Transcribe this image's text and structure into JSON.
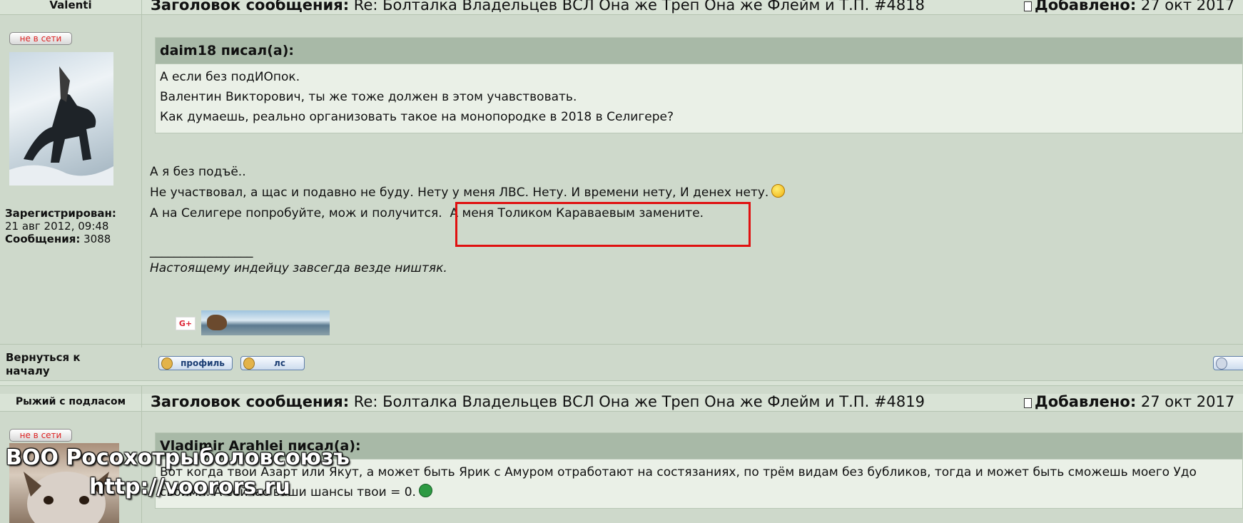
{
  "post1": {
    "author": "Valenti",
    "subject_label": "Заголовок сообщения:",
    "subject": "Re: Болталка Владельцев ВСЛ Она же Треп Она же Флейм и Т.П. #4818",
    "added_label": "Добавлено:",
    "added_value": "27 окт 2017",
    "status": "не в сети",
    "quote_author": "daim18 писал(а):",
    "quote_lines": [
      "А если без подИОпок.",
      "Валентин Викторович, ты же тоже должен в этом учавствовать.",
      "Как думаешь, реально организовать такое на монопородке в 2018 в Селигере?"
    ],
    "body_lines": [
      "А я без подъё..",
      "Не участвовал, а щас и подавно не буду. Нету у меня ЛВС. Нету. И времени нету, И денех нету.",
      "А на Селигере попробуйте, мож и получится.",
      "А меня Толиком Караваевым замените."
    ],
    "sig_separator": "_________________",
    "signature": "Настоящему индейцу завсегда везде ништяк.",
    "registered_label": "Зарегистрирован:",
    "registered_value": "21 авг 2012, 09:48",
    "messages_label": "Сообщения:",
    "messages_value": "3088",
    "back_to_top": "Вернуться к началу",
    "profile_btn": "профиль",
    "pm_btn": "лс",
    "gplus": "G+"
  },
  "post2": {
    "author": "Рыжий с подласом",
    "subject_label": "Заголовок сообщения:",
    "subject": "Re: Болталка Владельцев ВСЛ Она же Треп Она же Флейм и Т.П. #4819",
    "added_label": "Добавлено:",
    "added_value": "27 окт 2017",
    "status": "не в сети",
    "quote_author": "Vladimir Arahlei писал(а):",
    "quote_lines": [
      "Вот когда твои Азарт или Якут, а может быть Ярик с Амуром отработают на состязаниях, по трём видам без бубликов, тогда и может быть сможешь моего Удо",
      "своими. А сейчас ваши шансы твои = 0."
    ]
  },
  "watermark": {
    "line1": "ВОО Росохотрыболовсоюзъ",
    "line2": "http://voorors.ru"
  },
  "colors": {
    "background": "#ced9cb",
    "quote_header": "#a8b9a7",
    "quote_body": "#eaf0e7",
    "highlight": "#e01010",
    "offline": "#d22222"
  },
  "icons": {
    "added": "doc-icon",
    "wink": "wink-smiley-icon",
    "grin": "grin-smiley-icon",
    "profile": "profile-icon",
    "pm": "pm-icon"
  }
}
